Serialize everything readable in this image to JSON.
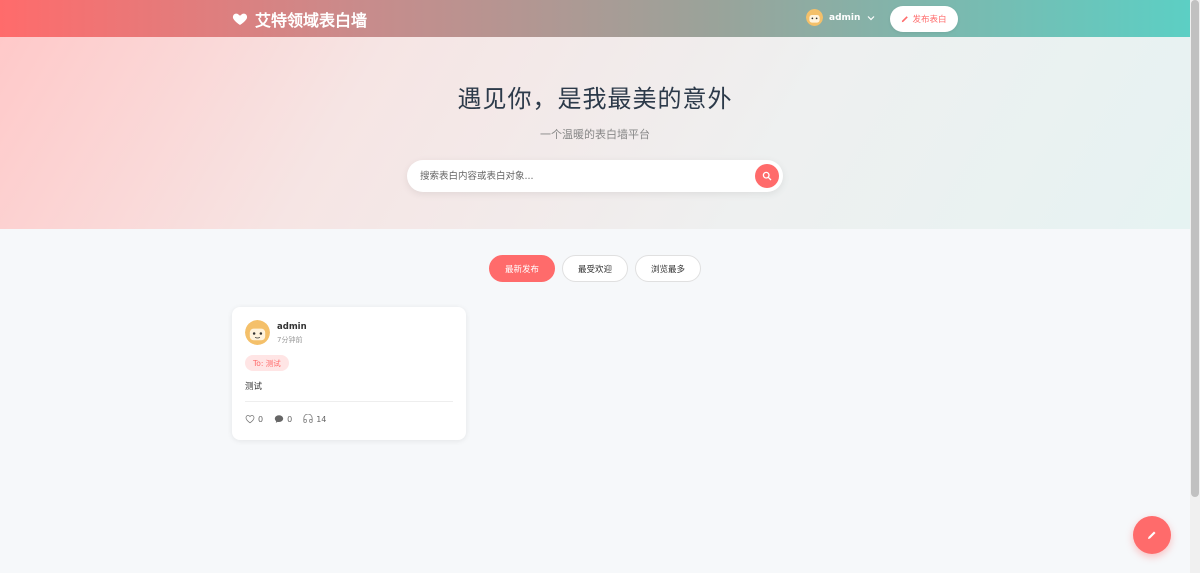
{
  "header": {
    "brand": "艾特领域表白墙",
    "user_name": "admin",
    "publish_label": "发布表白"
  },
  "hero": {
    "title": "遇见你，是我最美的意外",
    "subtitle": "一个温暖的表白墙平台",
    "search_placeholder": "搜索表白内容或表白对象..."
  },
  "tabs": [
    {
      "label": "最新发布",
      "active": true
    },
    {
      "label": "最受欢迎",
      "active": false
    },
    {
      "label": "浏览最多",
      "active": false
    }
  ],
  "posts": [
    {
      "author": "admin",
      "time": "7分钟前",
      "to": "To: 测试",
      "content": "测试",
      "likes": "0",
      "comments": "0",
      "views": "14"
    }
  ],
  "colors": {
    "accent": "#ff6b6b",
    "header_end": "#5ccfc4"
  },
  "icons": [
    "heart-icon",
    "chevron-down-icon",
    "pencil-icon",
    "search-icon",
    "like-icon",
    "comment-icon",
    "views-icon"
  ]
}
